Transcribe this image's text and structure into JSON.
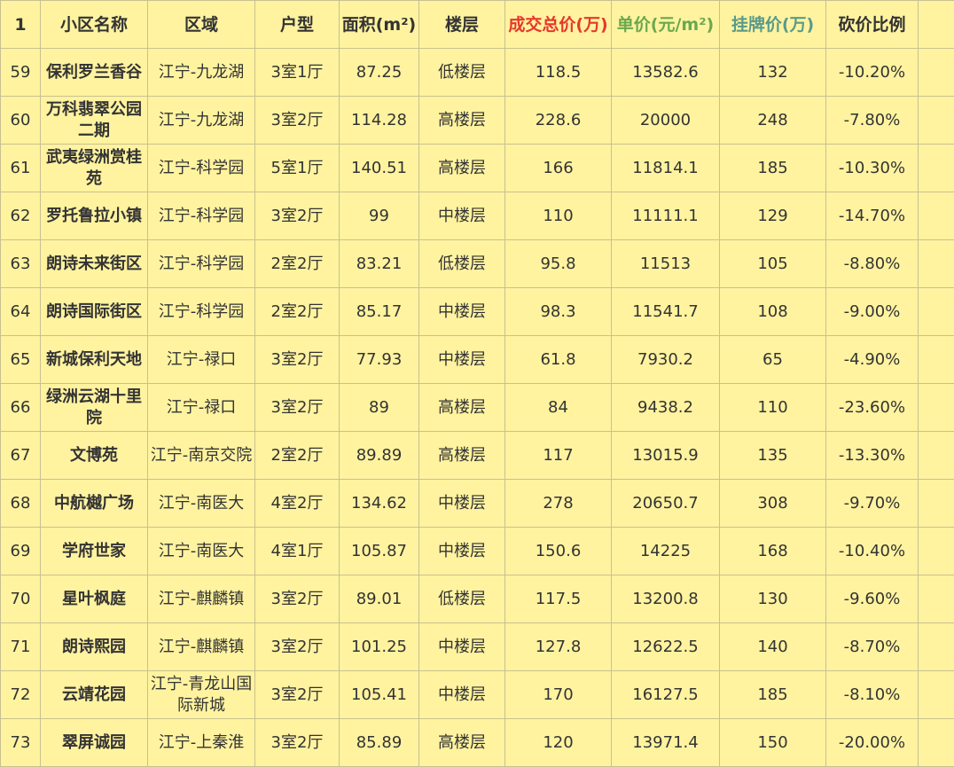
{
  "header": {
    "rownum": "1",
    "cols": [
      "小区名称",
      "区域",
      "户型",
      "面积(m²)",
      "楼层",
      "成交总价(万)",
      "单价(元/m²)",
      "挂牌价(万)",
      "砍价比例"
    ]
  },
  "rows": [
    {
      "n": "59",
      "name": "保利罗兰香谷",
      "area": "江宁-九龙湖",
      "type": "3室1厅",
      "size": "87.25",
      "floor": "低楼层",
      "total": "118.5",
      "unit": "13582.6",
      "list": "132",
      "cut": "-10.20%"
    },
    {
      "n": "60",
      "name": "万科翡翠公园二期",
      "area": "江宁-九龙湖",
      "type": "3室2厅",
      "size": "114.28",
      "floor": "高楼层",
      "total": "228.6",
      "unit": "20000",
      "list": "248",
      "cut": "-7.80%"
    },
    {
      "n": "61",
      "name": "武夷绿洲赏桂苑",
      "area": "江宁-科学园",
      "type": "5室1厅",
      "size": "140.51",
      "floor": "高楼层",
      "total": "166",
      "unit": "11814.1",
      "list": "185",
      "cut": "-10.30%"
    },
    {
      "n": "62",
      "name": "罗托鲁拉小镇",
      "area": "江宁-科学园",
      "type": "3室2厅",
      "size": "99",
      "floor": "中楼层",
      "total": "110",
      "unit": "11111.1",
      "list": "129",
      "cut": "-14.70%"
    },
    {
      "n": "63",
      "name": "朗诗未来街区",
      "area": "江宁-科学园",
      "type": "2室2厅",
      "size": "83.21",
      "floor": "低楼层",
      "total": "95.8",
      "unit": "11513",
      "list": "105",
      "cut": "-8.80%"
    },
    {
      "n": "64",
      "name": "朗诗国际街区",
      "area": "江宁-科学园",
      "type": "2室2厅",
      "size": "85.17",
      "floor": "中楼层",
      "total": "98.3",
      "unit": "11541.7",
      "list": "108",
      "cut": "-9.00%"
    },
    {
      "n": "65",
      "name": "新城保利天地",
      "area": "江宁-禄口",
      "type": "3室2厅",
      "size": "77.93",
      "floor": "中楼层",
      "total": "61.8",
      "unit": "7930.2",
      "list": "65",
      "cut": "-4.90%"
    },
    {
      "n": "66",
      "name": "绿洲云湖十里院",
      "area": "江宁-禄口",
      "type": "3室2厅",
      "size": "89",
      "floor": "高楼层",
      "total": "84",
      "unit": "9438.2",
      "list": "110",
      "cut": "-23.60%"
    },
    {
      "n": "67",
      "name": "文博苑",
      "area": "江宁-南京交院",
      "type": "2室2厅",
      "size": "89.89",
      "floor": "高楼层",
      "total": "117",
      "unit": "13015.9",
      "list": "135",
      "cut": "-13.30%"
    },
    {
      "n": "68",
      "name": "中航樾广场",
      "area": "江宁-南医大",
      "type": "4室2厅",
      "size": "134.62",
      "floor": "中楼层",
      "total": "278",
      "unit": "20650.7",
      "list": "308",
      "cut": "-9.70%"
    },
    {
      "n": "69",
      "name": "学府世家",
      "area": "江宁-南医大",
      "type": "4室1厅",
      "size": "105.87",
      "floor": "中楼层",
      "total": "150.6",
      "unit": "14225",
      "list": "168",
      "cut": "-10.40%"
    },
    {
      "n": "70",
      "name": "星叶枫庭",
      "area": "江宁-麒麟镇",
      "type": "3室2厅",
      "size": "89.01",
      "floor": "低楼层",
      "total": "117.5",
      "unit": "13200.8",
      "list": "130",
      "cut": "-9.60%"
    },
    {
      "n": "71",
      "name": "朗诗熙园",
      "area": "江宁-麒麟镇",
      "type": "3室2厅",
      "size": "101.25",
      "floor": "中楼层",
      "total": "127.8",
      "unit": "12622.5",
      "list": "140",
      "cut": "-8.70%"
    },
    {
      "n": "72",
      "name": "云靖花园",
      "area": "江宁-青龙山国际新城",
      "type": "3室2厅",
      "size": "105.41",
      "floor": "中楼层",
      "total": "170",
      "unit": "16127.5",
      "list": "185",
      "cut": "-8.10%"
    },
    {
      "n": "73",
      "name": "翠屏诚园",
      "area": "江宁-上秦淮",
      "type": "3室2厅",
      "size": "85.89",
      "floor": "高楼层",
      "total": "120",
      "unit": "13971.4",
      "list": "150",
      "cut": "-20.00%"
    }
  ]
}
